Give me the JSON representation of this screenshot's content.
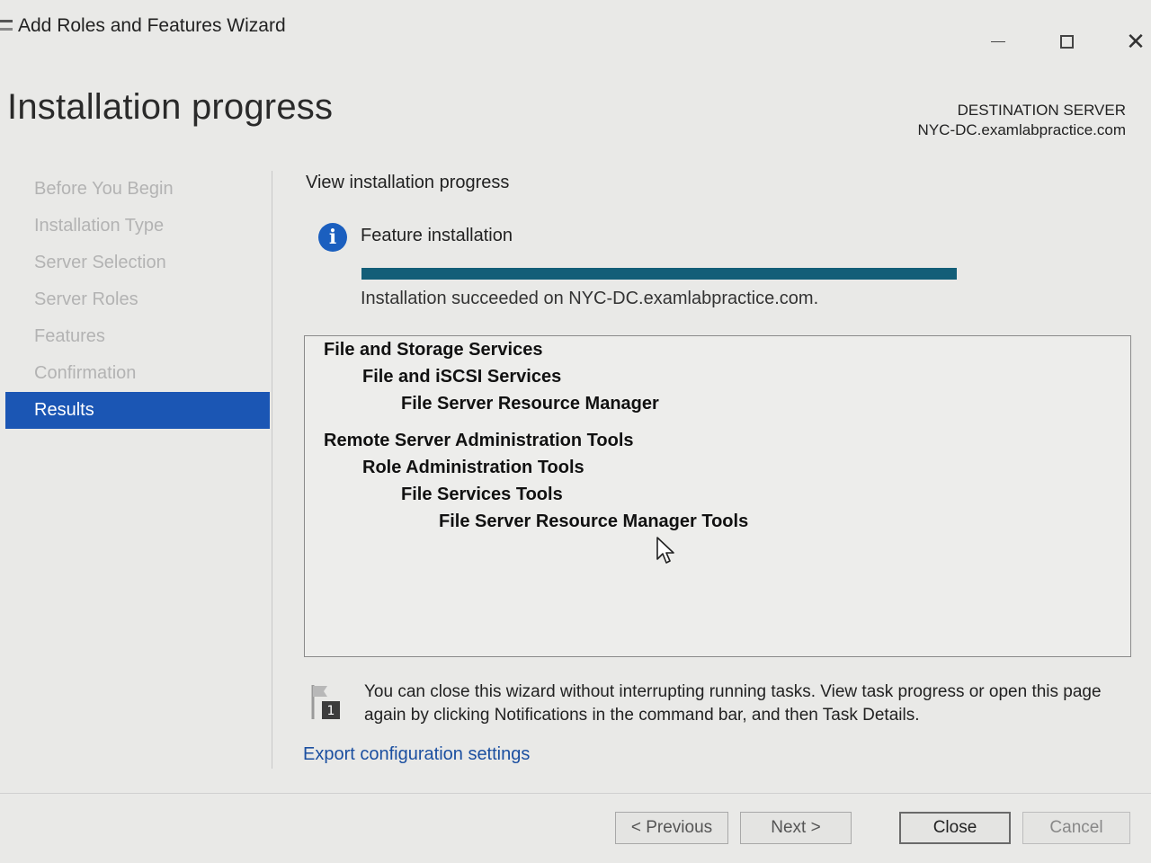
{
  "window": {
    "title": "Add Roles and Features Wizard",
    "controls": [
      "minimize",
      "maximize",
      "close"
    ],
    "close_glyph": "✕"
  },
  "page": {
    "heading": "Installation progress",
    "destination_label": "DESTINATION SERVER",
    "destination_server": "NYC-DC.examlabpractice.com"
  },
  "nav": {
    "items": [
      {
        "label": "Before You Begin",
        "active": false
      },
      {
        "label": "Installation Type",
        "active": false
      },
      {
        "label": "Server Selection",
        "active": false
      },
      {
        "label": "Server Roles",
        "active": false
      },
      {
        "label": "Features",
        "active": false
      },
      {
        "label": "Confirmation",
        "active": false
      },
      {
        "label": "Results",
        "active": true
      }
    ]
  },
  "main": {
    "section_title": "View installation progress",
    "info_icon": "i",
    "feature_label": "Feature installation",
    "progress_percent": 100,
    "success_message": "Installation succeeded on NYC-DC.examlabpractice.com.",
    "results": [
      {
        "text": "File and Storage Services",
        "level": 0
      },
      {
        "text": "File and iSCSI Services",
        "level": 1
      },
      {
        "text": "File Server Resource Manager",
        "level": 2
      },
      {
        "text": "Remote Server Administration Tools",
        "level": 0
      },
      {
        "text": "Role Administration Tools",
        "level": 1
      },
      {
        "text": "File Services Tools",
        "level": 2
      },
      {
        "text": "File Server Resource Manager Tools",
        "level": 3
      }
    ],
    "notification_badge": "1",
    "note": "You can close this wizard without interrupting running tasks. View task progress or open this page again by clicking Notifications in the command bar, and then Task Details.",
    "export_link": "Export configuration settings"
  },
  "footer": {
    "previous": "< Previous",
    "next": "Next >",
    "close": "Close",
    "cancel": "Cancel"
  },
  "colors": {
    "nav_active": "#1b56b4",
    "progress_fill": "#135e78",
    "info_icon": "#1b5fbf",
    "link": "#1b4fa0"
  }
}
